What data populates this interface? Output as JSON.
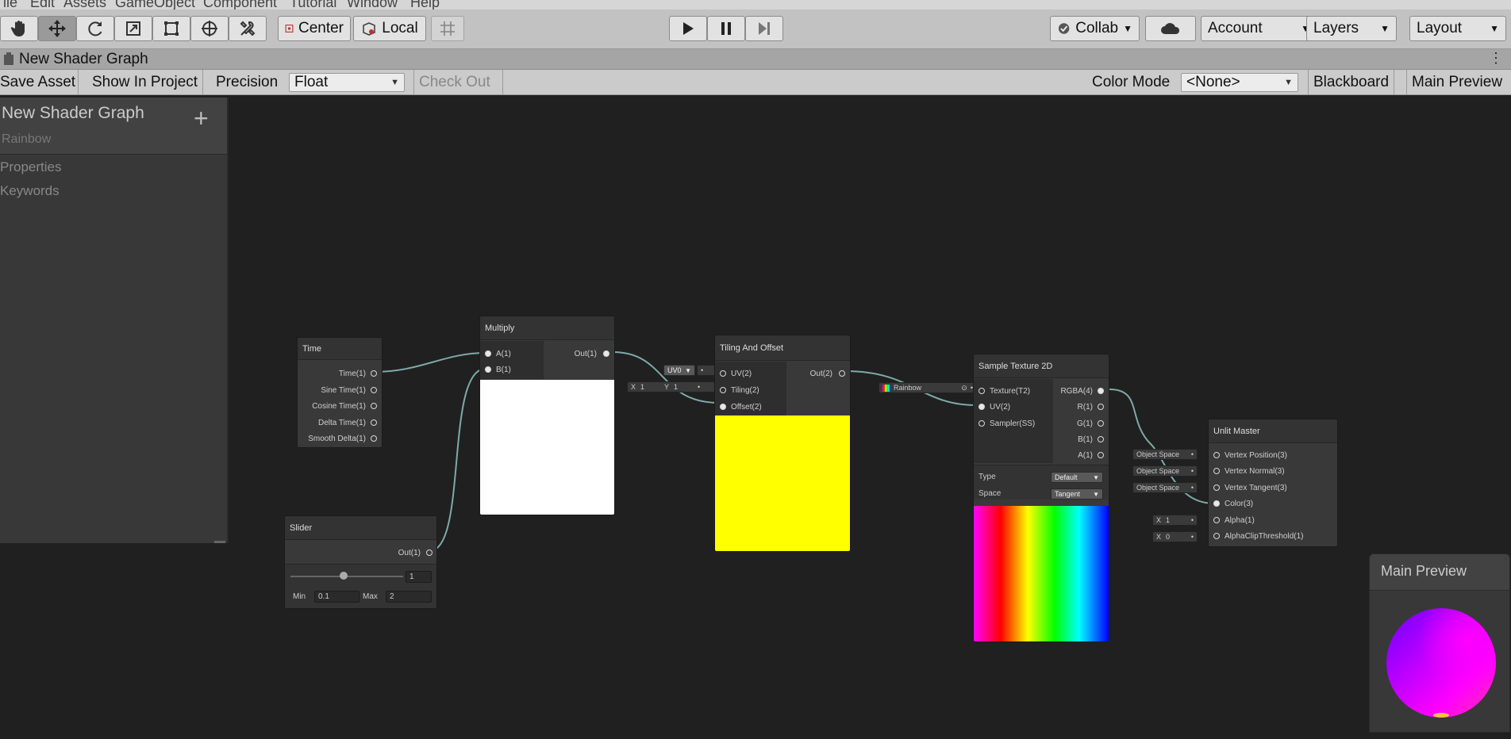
{
  "menu": {
    "items": [
      "ile",
      "Edit",
      "Assets",
      "GameObject",
      "Component",
      "Tutorial",
      "Window",
      "Help"
    ]
  },
  "toolbar": {
    "tools": [
      "hand-tool-icon",
      "move-tool-icon",
      "rotate-tool-icon",
      "scale-tool-icon",
      "rect-tool-icon",
      "transform-tool-icon",
      "custom-tool-icon"
    ],
    "pivot_label": "Center",
    "space_label": "Local",
    "collab_label": "Collab",
    "account_label": "Account",
    "layers_label": "Layers",
    "layout_label": "Layout"
  },
  "window": {
    "title": "New Shader Graph"
  },
  "sg_toolbar": {
    "save_label": "Save Asset",
    "show_label": "Show In Project",
    "precision_label": "Precision",
    "precision_value": "Float",
    "checkout_label": "Check Out",
    "color_mode_label": "Color Mode",
    "color_mode_value": "<None>",
    "blackboard_label": "Blackboard",
    "main_preview_label": "Main Preview"
  },
  "blackboard": {
    "title": "New Shader Graph",
    "subtitle": "Rainbow",
    "add_label": "+",
    "sections": [
      "Properties",
      "Keywords"
    ]
  },
  "nodes": {
    "time": {
      "title": "Time",
      "outputs": [
        "Time(1)",
        "Sine Time(1)",
        "Cosine Time(1)",
        "Delta Time(1)",
        "Smooth Delta(1)"
      ]
    },
    "slider": {
      "title": "Slider",
      "output": "Out(1)",
      "value": "1",
      "min_label": "Min",
      "min": "0.1",
      "max_label": "Max",
      "max": "2",
      "level": 0.47
    },
    "multiply": {
      "title": "Multiply",
      "inputs": [
        "A(1)",
        "B(1)"
      ],
      "output": "Out(1)"
    },
    "tiling": {
      "title": "Tiling And Offset",
      "inputs": [
        "UV(2)",
        "Tiling(2)",
        "Offset(2)"
      ],
      "output": "Out(2)",
      "uv_value": "UV0",
      "tiling_x_label": "X",
      "tiling_x": "1",
      "tiling_y_label": "Y",
      "tiling_y": "1"
    },
    "sample": {
      "title": "Sample Texture 2D",
      "inputs": [
        "Texture(T2)",
        "UV(2)",
        "Sampler(SS)"
      ],
      "outputs": [
        "RGBA(4)",
        "R(1)",
        "G(1)",
        "B(1)",
        "A(1)"
      ],
      "texture_value": "Rainbow",
      "type_label": "Type",
      "type_value": "Default",
      "space_label": "Space",
      "space_value": "Tangent"
    },
    "unlit": {
      "title": "Unlit Master",
      "inputs": [
        "Vertex Position(3)",
        "Vertex Normal(3)",
        "Vertex Tangent(3)",
        "Color(3)",
        "Alpha(1)",
        "AlphaClipThreshold(1)"
      ],
      "space_values": [
        "Object Space",
        "Object Space",
        "Object Space"
      ],
      "alpha_x_label": "X",
      "alpha_x": "1",
      "clip_x_label": "X",
      "clip_x": "0"
    }
  },
  "main_preview": {
    "title": "Main Preview"
  },
  "colors": {
    "wire": "#7fa9a9",
    "preview_yellow": "#ffff00",
    "canvas_bg": "#202020"
  }
}
